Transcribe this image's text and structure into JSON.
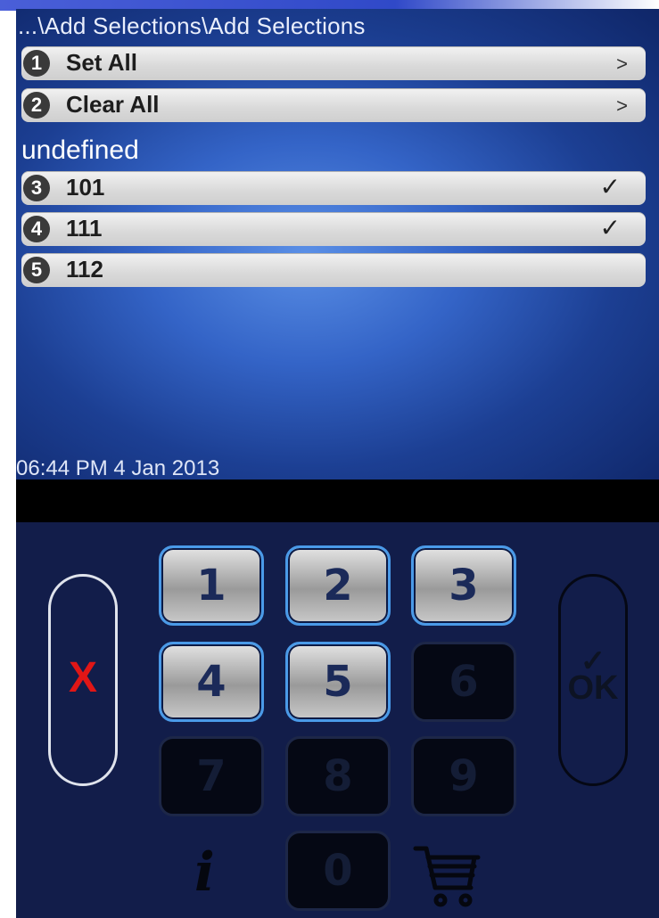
{
  "header": {
    "breadcrumb": "...\\Add Selections\\Add Selections"
  },
  "menu": [
    {
      "num": "1",
      "label": "Set All",
      "indicator": ">"
    },
    {
      "num": "2",
      "label": "Clear All",
      "indicator": ">"
    }
  ],
  "group": {
    "label": "undefined"
  },
  "items": [
    {
      "num": "3",
      "label": "101",
      "checked": true,
      "mark": "✓"
    },
    {
      "num": "4",
      "label": "111",
      "checked": true,
      "mark": "✓"
    },
    {
      "num": "5",
      "label": "112",
      "checked": false,
      "mark": ""
    }
  ],
  "status": {
    "datetime": "06:44 PM 4 Jan 2013"
  },
  "keypad": {
    "keys": [
      "1",
      "2",
      "3",
      "4",
      "5",
      "6",
      "7",
      "8",
      "9",
      "0"
    ],
    "enabled": [
      "1",
      "2",
      "3",
      "4",
      "5"
    ],
    "cancel_label": "X",
    "ok_label": "OK",
    "info_icon": "i"
  },
  "icons": {
    "cancel": "close-icon",
    "ok": "ok-check-icon",
    "info": "info-icon",
    "cart": "cart-icon"
  },
  "colors": {
    "accent": "#4a9ae8",
    "cancel": "#e01616",
    "background": "#121d4a"
  }
}
